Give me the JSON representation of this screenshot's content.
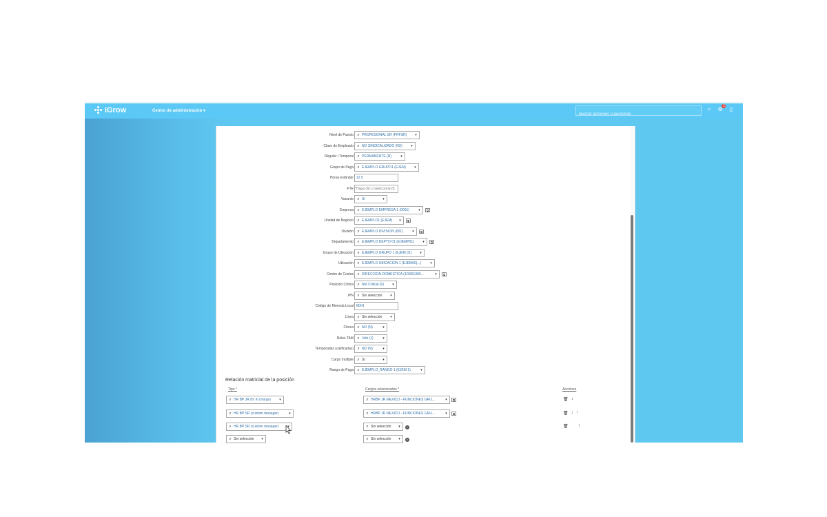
{
  "header": {
    "app_name": "iGrow",
    "admin_menu": "Centro de administración",
    "search_placeholder": "Buscar acciones o personas",
    "notification_count": "1"
  },
  "fields": [
    {
      "label": "Nivel de Puesto",
      "required": true,
      "type": "select",
      "value": "PROFESIONAL SR (PRFSR)",
      "width": 95,
      "ext": false
    },
    {
      "label": "Clase de Empleado",
      "required": true,
      "type": "select",
      "value": "NO SINDICALIZADO (NS)",
      "width": 89,
      "ext": false
    },
    {
      "label": "Regular / Temporal",
      "required": true,
      "type": "select",
      "value": "PERMANENTE (R)",
      "width": 74,
      "ext": false
    },
    {
      "label": "Grupo de Paga",
      "required": true,
      "type": "select",
      "value": "EJEMPLO GRUPO1 (EJEM)",
      "width": 94,
      "ext": false
    },
    {
      "label": "Horas estándar",
      "required": false,
      "type": "input",
      "value": "12.5",
      "width": 64,
      "ext": false
    },
    {
      "label": "FTE",
      "required": true,
      "type": "input",
      "value": "Haga clic o seleccione (i)",
      "placeholder": true,
      "width": 64,
      "ext": false
    },
    {
      "label": "Vacante",
      "required": true,
      "type": "select",
      "value": "Sí",
      "width": 48,
      "ext": false
    },
    {
      "label": "Empresa",
      "required": true,
      "type": "select",
      "value": "EJEMPLO EMPRESA 1 (0001)",
      "width": 100,
      "ext": true
    },
    {
      "label": "Unidad de Negocio",
      "required": true,
      "type": "select",
      "value": "EJEMPLO1 (EJEM)",
      "width": 72,
      "ext": true
    },
    {
      "label": "División",
      "required": true,
      "type": "select",
      "value": "EJEMPLO DIVISIÓN (001)",
      "width": 91,
      "ext": true
    },
    {
      "label": "Departamento",
      "required": true,
      "type": "select",
      "value": "EJEMPLO DEPTO 01 (EJEMP01)",
      "width": 106,
      "ext": true
    },
    {
      "label": "Grupo de Ubicación",
      "required": true,
      "type": "select",
      "value": "EJEMPLO GRUPO 1 (EJEM 01)",
      "width": 102,
      "ext": false
    },
    {
      "label": "Ubicación",
      "required": false,
      "type": "select",
      "value": "EJEMPLO UBICACIÓN 1 (EJEM00(...)",
      "width": 117,
      "ext": false
    },
    {
      "label": "Centro de Costos",
      "required": true,
      "type": "select",
      "value": "DIRECCIÓN DOMÉSTICA (1DS01300...",
      "width": 124,
      "ext": true
    },
    {
      "label": "Posición Crítica",
      "required": false,
      "type": "select",
      "value": "Not Critical (0)",
      "width": 62,
      "ext": false
    },
    {
      "label": "IPN",
      "required": false,
      "type": "select",
      "value": "Sin selección",
      "width": 59,
      "plain": true,
      "ext": false
    },
    {
      "label": "Código de Moneda Local",
      "required": false,
      "type": "input",
      "value": "MXN",
      "width": 64,
      "ext": false
    },
    {
      "label": "Línea",
      "required": false,
      "type": "select",
      "value": "Sin selección",
      "width": 59,
      "plain": true,
      "ext": false
    },
    {
      "label": "Checa",
      "required": false,
      "type": "select",
      "value": "NO (N)",
      "width": 48,
      "ext": false
    },
    {
      "label": "Roles TAM",
      "required": false,
      "type": "select",
      "value": "Jefe (J)",
      "width": 48,
      "ext": false
    },
    {
      "label": "Temporadas (calificadas)",
      "required": false,
      "type": "select",
      "value": "NO (N)",
      "width": 48,
      "ext": false
    },
    {
      "label": "Cargo múltiple",
      "required": false,
      "type": "select",
      "value": "Sí",
      "width": 48,
      "plain": true,
      "ext": false
    },
    {
      "label": "Rango de Paga",
      "required": false,
      "type": "select",
      "value": "EJEMPLO_RANGO 1 (EJEM 1)",
      "width": 103,
      "ext": false
    }
  ],
  "matrix": {
    "title": "Relación matricial de la posición",
    "col_type": "Tipo *",
    "col_position": "Cargos relacionados *",
    "col_actions": "Acciones",
    "rows": [
      {
        "type": "HR BP JR (hr in charge)",
        "position": "HRBP JR MÉXICO - FUNCIONES GRU...",
        "ext": true,
        "actions": [
          "trash",
          "down"
        ]
      },
      {
        "type": "HR BP SR (custom manager)",
        "position": "HRBP JR MÉXICO - FUNCIONES GRU...",
        "ext": true,
        "actions": [
          "trash",
          "down",
          "up"
        ]
      },
      {
        "type": "HR BP SR (custom manager)",
        "position": "Sin selección",
        "ext": false,
        "actions": [
          "trash",
          "up"
        ]
      },
      {
        "type": "Sin selección",
        "position": "Sin selección",
        "ext": false,
        "actions": []
      }
    ]
  }
}
